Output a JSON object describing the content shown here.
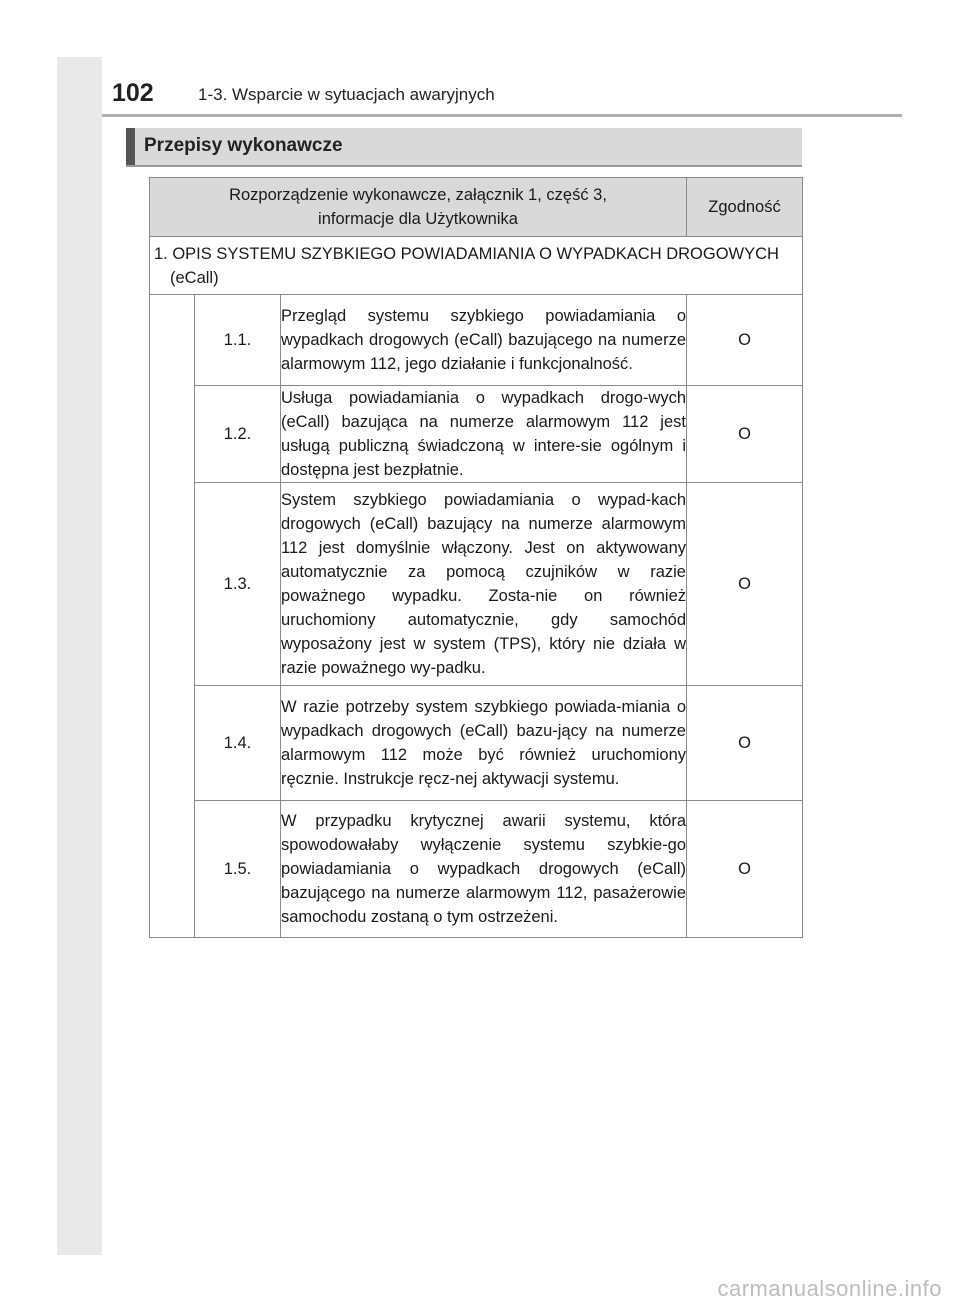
{
  "header": {
    "page_number": "102",
    "chapter": "1-3. Wsparcie w sytuacjach awaryjnych"
  },
  "section": {
    "title": "Przepisy wykonawcze"
  },
  "table": {
    "header_main": "Rozporządzenie wykonawcze, załącznik 1, część 3, informacje dla Użytkownika",
    "header_compliance": "Zgodność",
    "section_row": "1. OPIS SYSTEMU SZYBKIEGO POWIADAMIANIA O WYPADKACH DROGOWYCH (eCall)",
    "rows": [
      {
        "num": "1.1.",
        "text": "Przegląd systemu szybkiego powiadamiania o wypadkach drogowych (eCall) bazującego na numerze alarmowym 112, jego działanie i funkcjonalność.",
        "mark": "O"
      },
      {
        "num": "1.2.",
        "text": "Usługa powiadamiania o wypadkach drogo-wych (eCall) bazująca na numerze alarmowym 112 jest usługą publiczną świadczoną w intere-sie ogólnym i dostępna jest bezpłatnie.",
        "mark": "O"
      },
      {
        "num": "1.3.",
        "text": "System szybkiego powiadamiania o wypad-kach drogowych (eCall) bazujący na numerze alarmowym 112 jest domyślnie włączony. Jest on aktywowany automatycznie za pomocą czujników w razie poważnego wypadku. Zosta-nie on również uruchomiony automatycznie, gdy samochód wyposażony jest w system (TPS), który nie działa w razie poważnego wy-padku.",
        "mark": "O"
      },
      {
        "num": "1.4.",
        "text": "W razie potrzeby system szybkiego powiada-miania o wypadkach drogowych (eCall) bazu-jący na numerze alarmowym 112 może być również uruchomiony ręcznie. Instrukcje ręcz-nej aktywacji systemu.",
        "mark": "O"
      },
      {
        "num": "1.5.",
        "text": "W przypadku krytycznej awarii systemu, która spowodowałaby wyłączenie systemu szybkie-go powiadamiania o wypadkach drogowych (eCall) bazującego na numerze alarmowym 112, pasażerowie samochodu zostaną o tym ostrzeżeni.",
        "mark": "O"
      }
    ]
  },
  "watermark": "carmanualsonline.info"
}
